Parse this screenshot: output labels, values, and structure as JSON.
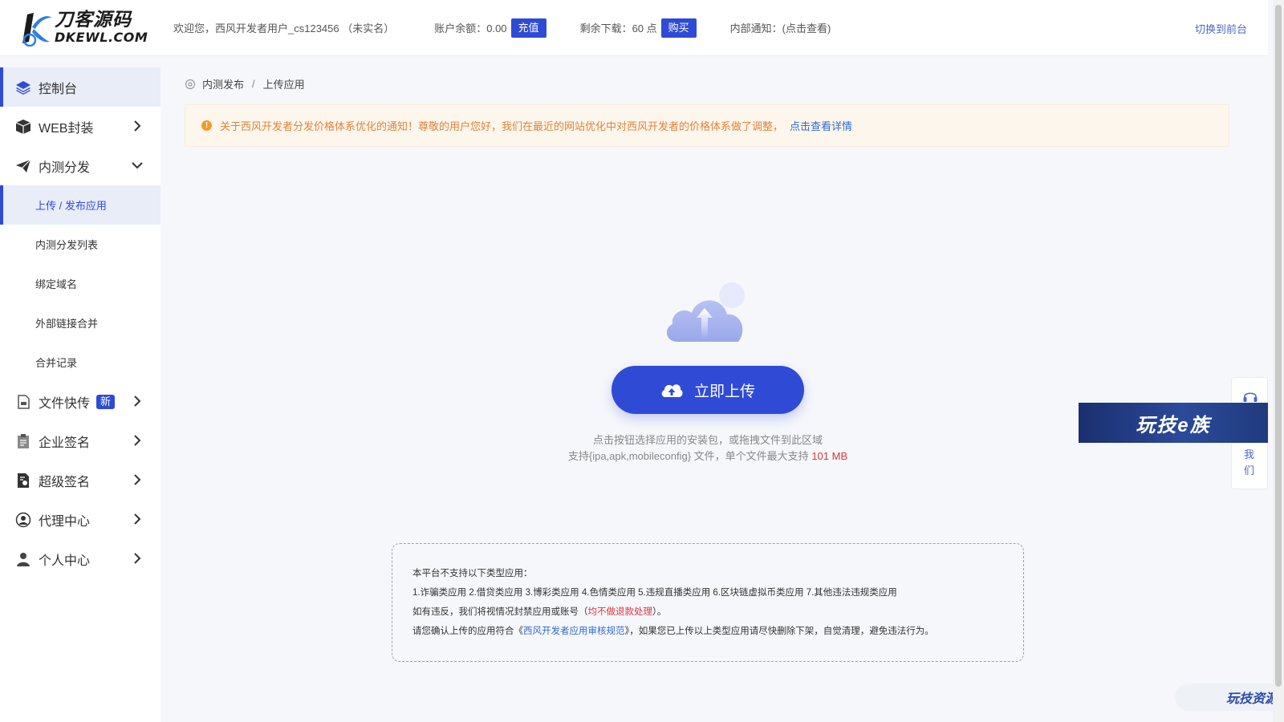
{
  "header": {
    "logo_cn": "刀客源码",
    "logo_en": "DKEWL.COM",
    "welcome": "欢迎您，西风开发者用户_cs123456 （未实名）",
    "balance_label": "账户余额：0.00",
    "recharge_btn": "充值",
    "download_label": "剩余下载：60 点",
    "buy_btn": "购买",
    "notice": "内部通知：(点击查看)",
    "switch": "切换到前台"
  },
  "sidebar": {
    "items": [
      {
        "label": "控制台",
        "icon": "layers-icon"
      },
      {
        "label": "WEB封装",
        "icon": "box-icon"
      },
      {
        "label": "内测分发",
        "icon": "send-icon"
      },
      {
        "label": "文件快传",
        "icon": "file-icon",
        "badge": "新"
      },
      {
        "label": "企业签名",
        "icon": "clipboard-icon"
      },
      {
        "label": "超级签名",
        "icon": "certificate-icon"
      },
      {
        "label": "代理中心",
        "icon": "agent-icon"
      },
      {
        "label": "个人中心",
        "icon": "user-icon"
      }
    ],
    "sub_items": [
      "上传 / 发布应用",
      "内测分发列表",
      "绑定域名",
      "外部链接合并",
      "合并记录"
    ]
  },
  "breadcrumb": {
    "parent": "内测发布",
    "sep": "/",
    "current": "上传应用"
  },
  "notice_bar": {
    "text": "关于西风开发者分发价格体系优化的通知！尊敬的用户您好，我们在最近的网站优化中对西风开发者的价格体系做了调整，",
    "link": "点击查看详情"
  },
  "upload": {
    "button": "立即上传",
    "tip1": "点击按钮选择应用的安装包，或拖拽文件到此区域",
    "tip2_prefix": "支持{ipa,apk,mobileconfig} 文件，单个文件最大支持",
    "tip2_size": "101 MB"
  },
  "rules": {
    "line1": "本平台不支持以下类型应用：",
    "line2": "1.诈骗类应用 2.借贷类应用 3.博彩类应用 4.色情类应用 5.违规直播类应用 6.区块链虚拟币类应用 7.其他违法违规类应用",
    "line3_prefix": "如有违反，我们将视情况封禁应用或账号（",
    "line3_red": "均不做退款处理",
    "line3_suffix": "）。",
    "line4_prefix": "请您确认上传的应用符合《",
    "line4_link": "西风开发者应用审核规范",
    "line4_suffix": "》，如果您已上传以上类型应用请尽快删除下架，自觉清理，避免违法行为。"
  },
  "float": {
    "contact": "我们",
    "brand_banner": "玩技e族",
    "brand_bottom": "玩技资源"
  },
  "colors": {
    "primary": "#2f4bd6",
    "warning": "#e0843a",
    "danger": "#d9363e"
  }
}
